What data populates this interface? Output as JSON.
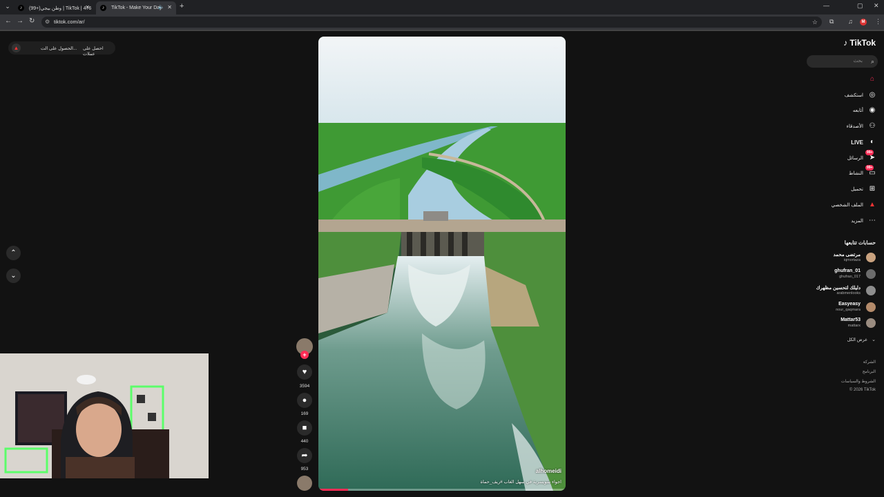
{
  "browser": {
    "tabs": [
      {
        "title": "(99+)وطن بيجي | TikTok | 476",
        "active": false
      },
      {
        "title": "TikTok - Make Your Day",
        "active": true
      }
    ],
    "url": "tiktok.com/ar/",
    "profile_initial": "M"
  },
  "top_pill": {
    "coins_label": "احصل على عملات",
    "app_label": "الحصول على الت..."
  },
  "sidebar": {
    "logo": "TikTok",
    "search_placeholder": "بحث",
    "nav": [
      {
        "label": "",
        "icon": "home-icon"
      },
      {
        "label": "استكشف",
        "icon": "compass-icon"
      },
      {
        "label": "أتابعه",
        "icon": "following-icon"
      },
      {
        "label": "الأصدقاء",
        "icon": "friends-icon"
      },
      {
        "label": "LIVE",
        "icon": "live-icon"
      },
      {
        "label": "الرسائل",
        "icon": "messages-icon",
        "badge": "99+"
      },
      {
        "label": "النشاط",
        "icon": "activity-icon",
        "badge": "99+"
      },
      {
        "label": "تحميل",
        "icon": "upload-icon"
      },
      {
        "label": "الملف الشخصي",
        "icon": "profile-icon"
      },
      {
        "label": "المزيد",
        "icon": "more-icon"
      }
    ],
    "following_title": "حسابات تتابعها",
    "following": [
      {
        "name": "مرتضى محمد",
        "handle": "iqmortaza"
      },
      {
        "name": "ghufran_01",
        "handle": "ghufran_017"
      },
      {
        "name": "دليلك لتحسين مظهرك",
        "handle": "arabmenlooks"
      },
      {
        "name": "Easyeasy",
        "handle": "nour_qaqmara"
      },
      {
        "name": "Mattar53",
        "handle": "mattarx"
      }
    ],
    "see_all": "عرض الكل",
    "footer": [
      "الشركة",
      "البرنامج",
      "الشروط والسياسات",
      "© 2026 TikTok"
    ]
  },
  "video": {
    "author": "alhomeidi",
    "caption": "اجواء سويسرية في سهل الغاب #ريف_حماة",
    "progress": 0.12
  },
  "actions": {
    "likes": "3594",
    "comments": "169",
    "saves": "440",
    "shares": "953"
  },
  "colors": {
    "accent": "#fe2c55",
    "background": "#121212"
  }
}
